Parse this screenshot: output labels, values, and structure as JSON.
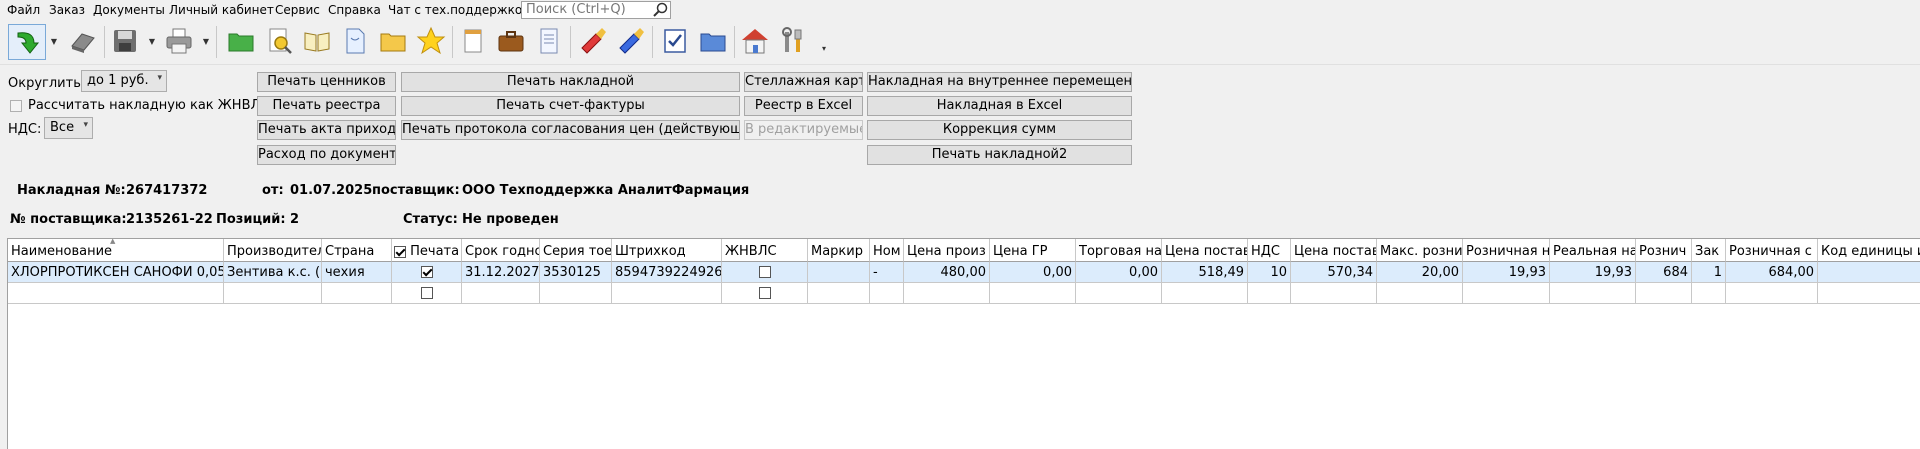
{
  "menu": {
    "items": [
      "Файл",
      "Заказ",
      "Документы",
      "Личный кабинет",
      "Сервис",
      "Справка",
      "Чат с тех.поддержкой"
    ],
    "search_placeholder": "Поиск (Ctrl+Q)"
  },
  "toolbar": {
    "icons": [
      "green-arrow-icon",
      "eraser-icon",
      "save-disk-icon",
      "printer-icon",
      "green-folder-icon",
      "search-document-icon",
      "open-book-icon",
      "document-icon",
      "yellow-folder-icon",
      "star-icon",
      "notepad-icon",
      "briefcase-icon",
      "document-lines-icon",
      "red-brush-icon",
      "blue-brush-icon",
      "checklist-icon",
      "blue-folder-icon",
      "home-icon",
      "tools-icon"
    ]
  },
  "controls": {
    "round_label": "Округлить:",
    "round_value": "до 1 руб.",
    "zhnvls_checkbox_label": "Рассчитать накладную как ЖНВЛС",
    "nds_label": "НДС:",
    "nds_value": "Все"
  },
  "buttons": {
    "print_price_tags": "Печать ценников",
    "print_invoice": "Печать накладной",
    "rack_card": "Стеллажная карта",
    "internal_transfer": "Накладная на внутреннее перемещение",
    "print_registry": "Печать реестра",
    "print_invoice_factura": "Печать счет-фактуры",
    "registry_excel": "Реестр в Excel",
    "invoice_excel": "Накладная в Excel",
    "print_receipt_act": "Печать акта прихода",
    "print_price_protocol": "Печать протокола согласования цен (действующий)",
    "to_editable": "В редактируемые",
    "sum_correction": "Коррекция сумм",
    "expense_by_document": "Расход по документу",
    "print_invoice2": "Печать накладной2"
  },
  "doc": {
    "invoice_no_label": "Накладная №:",
    "invoice_no": "267417372",
    "from_label": "от:",
    "date": "01.07.2025",
    "supplier_label": "поставщик:",
    "supplier": "ООО Техподдержка АналитФармация",
    "supplier_no_label": "№ поставщика:",
    "supplier_no": "2135261-22",
    "positions_label": "Позиций:",
    "positions": "2",
    "status_label": "Статус:",
    "status": "Не проведен"
  },
  "grid": {
    "columns": [
      "Наименование",
      "Производител",
      "Страна",
      "Печата",
      "Срок годнс",
      "Серия тое",
      "Штрихкод",
      "ЖНВЛС",
      "Маркир",
      "Ном",
      "Цена произ",
      "Цена ГР",
      "Торговая на",
      "Цена постав",
      "НДС",
      "Цена постав",
      "Макс. розни",
      "Розничная н",
      "Реальная на",
      "Рознич",
      "Зак",
      "Розничная с",
      "Код единицы и"
    ],
    "rows": [
      {
        "name": "ХЛОРПРОТИКСЕН САНОФИ 0,05",
        "producer": "Зентива к.с. (Ч",
        "country": "чехия",
        "print": true,
        "expiry": "31.12.2027",
        "series": "3530125",
        "barcode": "8594739224926",
        "zhnvls": false,
        "marking": "",
        "nom": "-",
        "producer_price": "480,00",
        "price_gr": "0,00",
        "trade_markup": "0,00",
        "supplier_price": "518,49",
        "nds": "10",
        "supplier_price_nds": "570,34",
        "max_retail": "20,00",
        "retail_markup": "19,93",
        "real_markup": "19,93",
        "retail": "684",
        "order": "1",
        "retail_sum": "684,00",
        "unit_code": ""
      }
    ]
  }
}
